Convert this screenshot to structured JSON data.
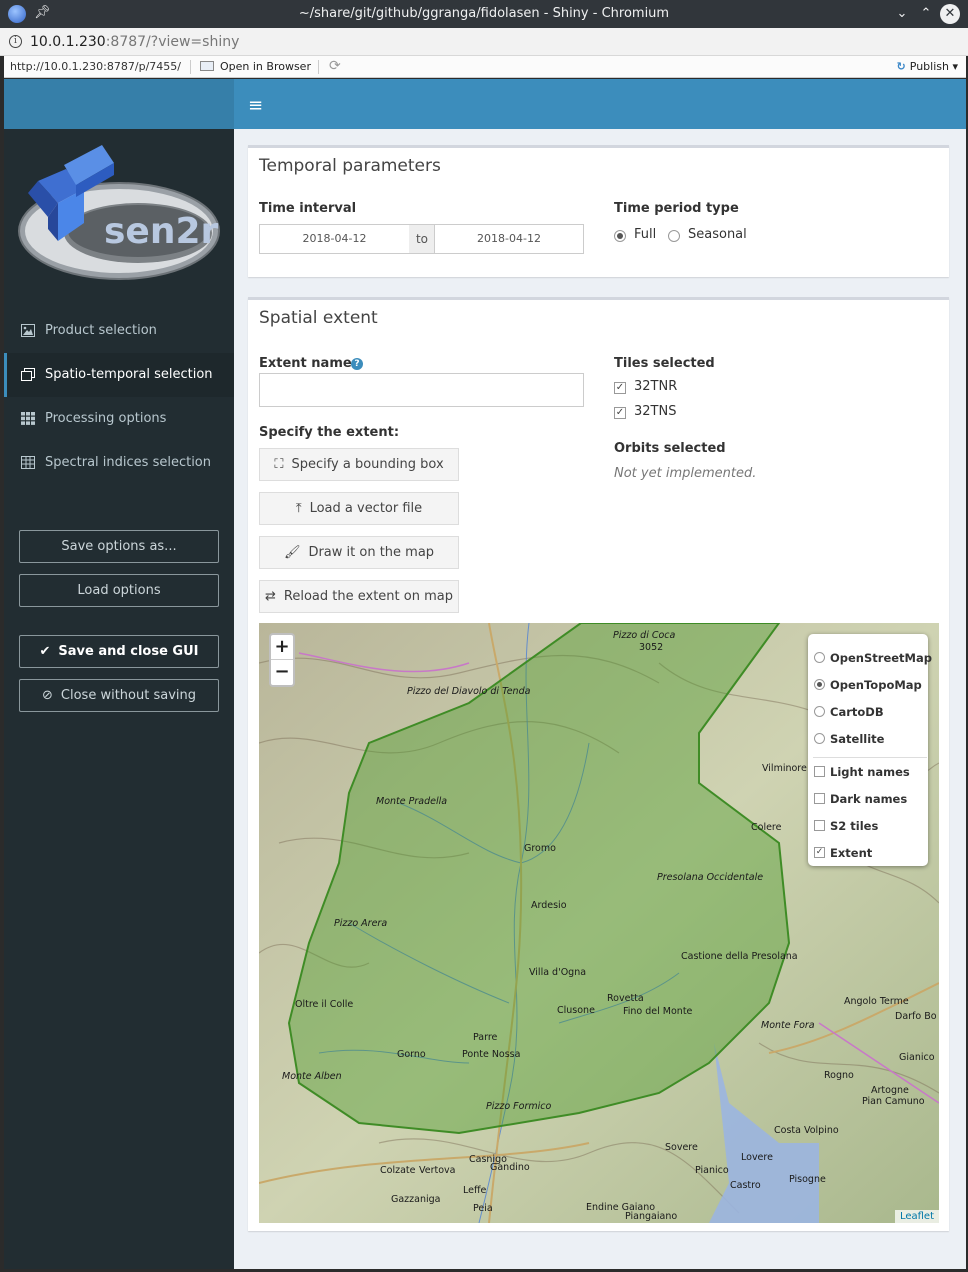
{
  "window": {
    "title": "~/share/git/github/ggranga/fidolasen - Shiny - Chromium",
    "buttons": {
      "minimize": "⌄",
      "maximize": "⌃",
      "close": "✕"
    }
  },
  "address": {
    "host": "10.0.1.230",
    "rest": ":8787/?view=shiny"
  },
  "viewer": {
    "url": "http://10.0.1.230:8787/p/7455/",
    "open_in_browser": "Open in Browser",
    "publish": "Publish"
  },
  "header": {
    "menu_icon": "≡"
  },
  "logo": {
    "text": "sen2r"
  },
  "sidebar": {
    "items": [
      {
        "label": "Product selection"
      },
      {
        "label": "Spatio-temporal selection"
      },
      {
        "label": "Processing options"
      },
      {
        "label": "Spectral indices selection"
      }
    ],
    "buttons": {
      "save_as": "Save options as...",
      "load": "Load options",
      "save_close": "Save and close GUI",
      "close_nosave": "Close without saving"
    }
  },
  "temporal": {
    "title": "Temporal parameters",
    "interval_label": "Time interval",
    "start_date": "2018-04-12",
    "to": "to",
    "end_date": "2018-04-12",
    "period_label": "Time period type",
    "period_options": [
      "Full",
      "Seasonal"
    ],
    "period_selected": "Full"
  },
  "spatial": {
    "title": "Spatial extent",
    "extent_name_label": "Extent name:",
    "extent_name_value": "",
    "specify_label": "Specify the extent:",
    "buttons": {
      "bbox": "Specify a bounding box",
      "vector": "Load a vector file",
      "draw": "Draw it on the map",
      "reload": "Reload the extent on map"
    },
    "tiles_label": "Tiles selected",
    "tiles": [
      "32TNR",
      "32TNS"
    ],
    "orbits_label": "Orbits selected",
    "orbits_value": "Not yet implemented."
  },
  "map": {
    "zoom_in": "+",
    "zoom_out": "−",
    "base_layers": [
      "OpenStreetMap",
      "OpenTopoMap",
      "CartoDB",
      "Satellite"
    ],
    "base_selected": "OpenTopoMap",
    "overlays": [
      {
        "label": "Light names",
        "checked": false
      },
      {
        "label": "Dark names",
        "checked": false
      },
      {
        "label": "S2 tiles",
        "checked": false
      },
      {
        "label": "Extent",
        "checked": true
      }
    ],
    "attribution": "Leaflet",
    "place_labels": [
      "Pizzo di Coca",
      "3052",
      "Pizzo del Diavolo di Tenda",
      "Vilminore di Scalve",
      "Monte Pradella",
      "Gromo",
      "Colere",
      "Presolana Occidentale",
      "Ardesio",
      "Pizzo Arera",
      "Villa d'Ogna",
      "Castione della Presolana",
      "Oltre il Colle",
      "Clusone",
      "Rovetta",
      "Fino del Monte",
      "Angolo Terme",
      "Darfo Bo",
      "Parre",
      "Monte Fora",
      "Gorno",
      "Ponte Nossa",
      "Gianico",
      "Monte Alben",
      "Rogno",
      "Artogne",
      "Pian Camuno",
      "Pizzo Formico",
      "Costa Volpino",
      "Sovere",
      "Lovere",
      "Casnigo",
      "Colzate",
      "Vertova",
      "Gandino",
      "Pianico",
      "Castro",
      "Pisogne",
      "Gazzaniga",
      "Leffe",
      "Peia",
      "Endine Gaiano",
      "Piangaiano"
    ]
  },
  "colors": {
    "header": "#3c8dbc",
    "sidebar": "#222d32",
    "extent_fill": "#4c9a2a"
  }
}
